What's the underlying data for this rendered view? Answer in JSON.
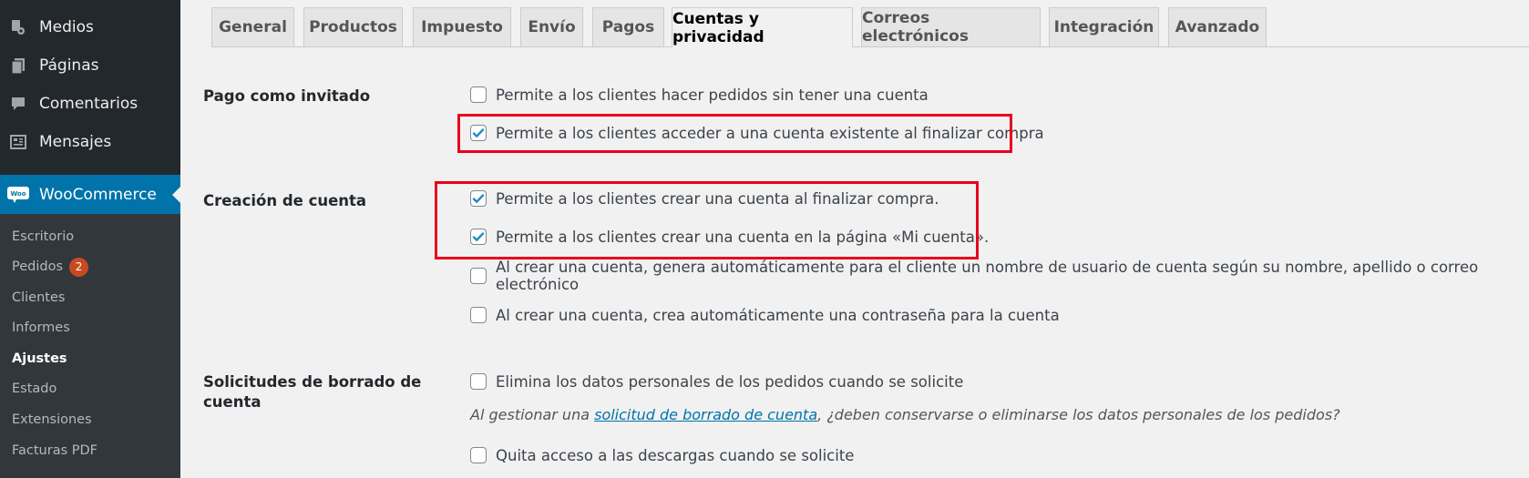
{
  "sidebar": {
    "menu": [
      {
        "label": "Medios",
        "icon": "media-icon"
      },
      {
        "label": "Páginas",
        "icon": "pages-icon"
      },
      {
        "label": "Comentarios",
        "icon": "comments-icon"
      },
      {
        "label": "Mensajes",
        "icon": "messages-icon"
      }
    ],
    "woocommerce": {
      "label": "WooCommerce",
      "icon": "woocommerce-icon",
      "icon_text": "Woo"
    },
    "submenu": [
      {
        "label": "Escritorio"
      },
      {
        "label": "Pedidos",
        "badge": "2"
      },
      {
        "label": "Clientes"
      },
      {
        "label": "Informes"
      },
      {
        "label": "Ajustes",
        "current": true
      },
      {
        "label": "Estado"
      },
      {
        "label": "Extensiones"
      },
      {
        "label": "Facturas PDF"
      }
    ]
  },
  "tabs": [
    {
      "label": "General"
    },
    {
      "label": "Productos"
    },
    {
      "label": "Impuesto"
    },
    {
      "label": "Envío"
    },
    {
      "label": "Pagos"
    },
    {
      "label": "Cuentas y privacidad",
      "active": true
    },
    {
      "label": "Correos electrónicos"
    },
    {
      "label": "Integración"
    },
    {
      "label": "Avanzado"
    }
  ],
  "sections": {
    "guest": {
      "label": "Pago como invitado",
      "options": [
        {
          "text": "Permite a los clientes hacer pedidos sin tener una cuenta",
          "checked": false
        },
        {
          "text": "Permite a los clientes acceder a una cuenta existente al finalizar compra",
          "checked": true
        }
      ]
    },
    "account": {
      "label": "Creación de cuenta",
      "options": [
        {
          "text": "Permite a los clientes crear una cuenta al finalizar compra.",
          "checked": true
        },
        {
          "text": "Permite a los clientes crear una cuenta en la página «Mi cuenta».",
          "checked": true
        },
        {
          "text": "Al crear una cuenta, genera automáticamente para el cliente un nombre de usuario de cuenta según su nombre, apellido o correo electrónico",
          "checked": false
        },
        {
          "text": "Al crear una cuenta, crea automáticamente una contraseña para la cuenta",
          "checked": false
        }
      ]
    },
    "erasure": {
      "label_line1": "Solicitudes de borrado de",
      "label_line2": "cuenta",
      "options": [
        {
          "text": "Elimina los datos personales de los pedidos cuando se solicite",
          "checked": false
        },
        {
          "text": "Quita acceso a las descargas cuando se solicite",
          "checked": false
        }
      ],
      "description": {
        "before": "Al gestionar una ",
        "link": "solicitud de borrado de cuenta",
        "after": ", ¿deben conservarse o eliminarse los datos personales de los pedidos?"
      }
    }
  },
  "colors": {
    "highlight": "#e8001c",
    "accent": "#0073aa",
    "sidebar": "#23282d",
    "badge": "#ca4a1f"
  }
}
